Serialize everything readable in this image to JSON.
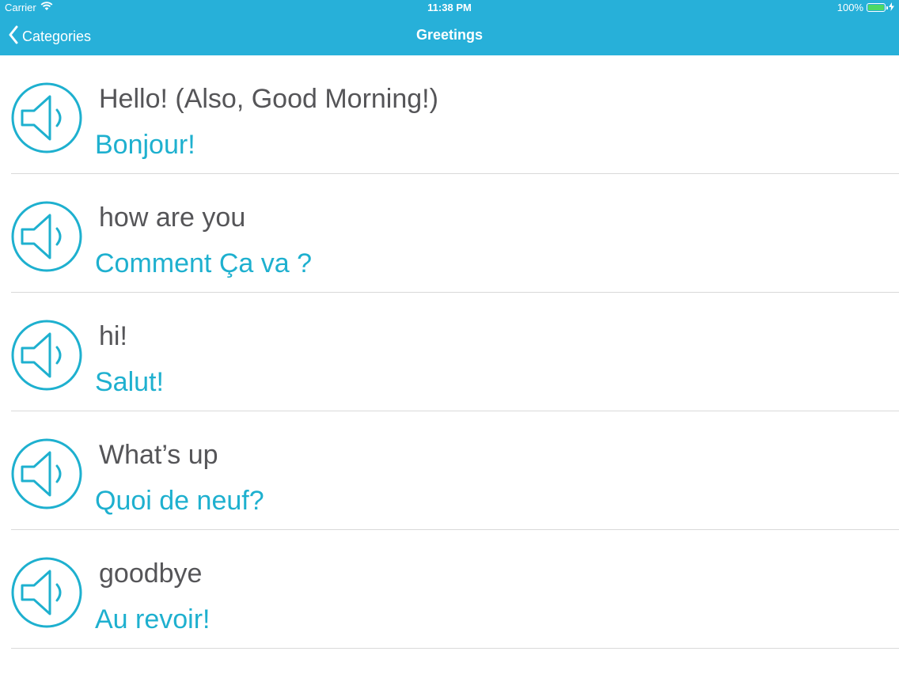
{
  "status_bar": {
    "carrier": "Carrier",
    "time": "11:38 PM",
    "battery": "100%",
    "icons": [
      "wifi-icon",
      "battery-icon",
      "charging-bolt-icon"
    ]
  },
  "nav": {
    "back_label": "Categories",
    "title": "Greetings",
    "back_icon": "chevron-left-icon"
  },
  "colors": {
    "bar": "#27b0d9",
    "accent": "#1eb0cf",
    "english_text": "#555558",
    "battery": "#4cd964"
  },
  "phrases": [
    {
      "english": "Hello! (Also, Good Morning!)",
      "french": "Bonjour!",
      "icon": "speaker-icon"
    },
    {
      "english": "how are you",
      "french": "Comment Ça va ?",
      "icon": "speaker-icon"
    },
    {
      "english": "hi!",
      "french": "Salut!",
      "icon": "speaker-icon"
    },
    {
      "english": "What’s up",
      "french": "Quoi de neuf?",
      "icon": "speaker-icon"
    },
    {
      "english": "goodbye",
      "french": "Au revoir!",
      "icon": "speaker-icon"
    }
  ]
}
